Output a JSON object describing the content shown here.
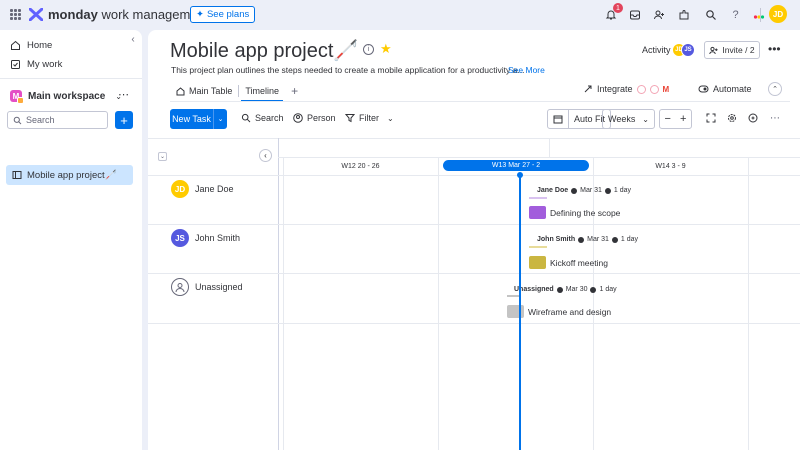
{
  "app": {
    "brand_bold": "monday",
    "brand_light": "work management",
    "see_plans": "See plans",
    "notification_count": "1",
    "user_initials": "JD"
  },
  "sidebar": {
    "home": "Home",
    "my_work": "My work",
    "workspace": "Main workspace",
    "workspace_initial": "M",
    "search_placeholder": "Search",
    "board": "Mobile app project🦯"
  },
  "board": {
    "title": "Mobile app project🦯",
    "description": "This project plan outlines the steps needed to create a mobile application for a productivity a...",
    "see_more": "See More",
    "activity": "Activity",
    "activity_avatars": [
      "JD",
      "JS"
    ],
    "invite": "Invite / 2",
    "tabs": [
      {
        "label": "Main Table"
      },
      {
        "label": "Timeline"
      }
    ],
    "integrate": "Integrate",
    "automate": "Automate"
  },
  "toolbar": {
    "new_task": "New Task",
    "search": "Search",
    "person": "Person",
    "filter": "Filter",
    "auto_fit": "Auto Fit",
    "zoom_unit": "Weeks",
    "minus": "−",
    "plus": "+"
  },
  "timeline": {
    "weeks": [
      "W12 20 - 26",
      "W13 Mar 27 - 2",
      "W14 3 - 9"
    ],
    "current_week_index": 1,
    "rows": [
      {
        "person": "Jane Doe",
        "initials": "JD",
        "avatar_color": "#ffcb00",
        "owner_label": "Jane Doe",
        "date": "Mar 31",
        "duration": "1 day",
        "task": "Defining the scope",
        "color": "#a25ddc"
      },
      {
        "person": "John Smith",
        "initials": "JS",
        "avatar_color": "#5559df",
        "owner_label": "John Smith",
        "date": "Mar 31",
        "duration": "1 day",
        "task": "Kickoff meeting",
        "color": "#cab641"
      },
      {
        "person": "Unassigned",
        "initials": "",
        "avatar_color": "#ffffff",
        "owner_label": "Unassigned",
        "date": "Mar 30",
        "duration": "1 day",
        "task": "Wireframe and design",
        "color": "#c4c4c4"
      }
    ]
  }
}
